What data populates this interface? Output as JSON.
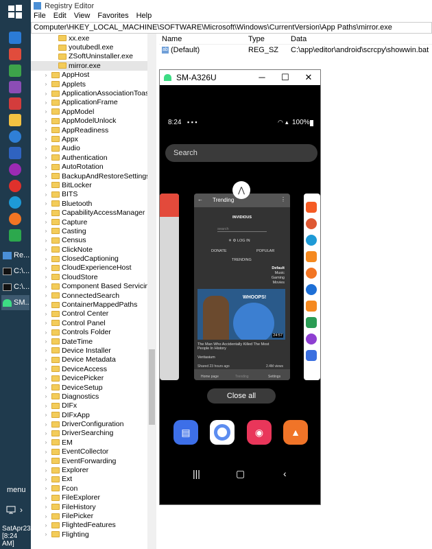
{
  "taskbar": {
    "apps": [
      {
        "label": "Re..."
      },
      {
        "label": "C:\\..."
      },
      {
        "label": "C:\\..."
      },
      {
        "label": "SM..."
      }
    ],
    "menu_label": "menu",
    "clock": {
      "date": "SatApr23",
      "time": "[8:24 AM]"
    }
  },
  "registry": {
    "title": "Registry Editor",
    "menu": [
      "File",
      "Edit",
      "View",
      "Favorites",
      "Help"
    ],
    "address": "Computer\\HKEY_LOCAL_MACHINE\\SOFTWARE\\Microsoft\\Windows\\CurrentVersion\\App Paths\\mirror.exe",
    "tree_children": [
      "xx.exe",
      "youtubedl.exe",
      "ZSoftUninstaller.exe",
      "mirror.exe"
    ],
    "tree_items": [
      "AppHost",
      "Applets",
      "ApplicationAssociationToasts",
      "ApplicationFrame",
      "AppModel",
      "AppModelUnlock",
      "AppReadiness",
      "Appx",
      "Audio",
      "Authentication",
      "AutoRotation",
      "BackupAndRestoreSettings",
      "BitLocker",
      "BITS",
      "Bluetooth",
      "CapabilityAccessManager",
      "Capture",
      "Casting",
      "Census",
      "ClickNote",
      "ClosedCaptioning",
      "CloudExperienceHost",
      "CloudStore",
      "Component Based Servicing",
      "ConnectedSearch",
      "ContainerMappedPaths",
      "Control Center",
      "Control Panel",
      "Controls Folder",
      "DateTime",
      "Device Installer",
      "Device Metadata",
      "DeviceAccess",
      "DevicePicker",
      "DeviceSetup",
      "Diagnostics",
      "DIFx",
      "DIFxApp",
      "DriverConfiguration",
      "DriverSearching",
      "EM",
      "EventCollector",
      "EventForwarding",
      "Explorer",
      "Ext",
      "Fcon",
      "FileExplorer",
      "FileHistory",
      "FilePicker",
      "FlightedFeatures",
      "Flighting"
    ],
    "columns": [
      "Name",
      "Type",
      "Data"
    ],
    "values": [
      {
        "name": "(Default)",
        "type": "REG_SZ",
        "data": "C:\\app\\editor\\android\\scrcpy\\showwin.bat"
      }
    ]
  },
  "phone": {
    "window_title": "SM-A326U",
    "time": "8:24",
    "battery": "100%",
    "search_placeholder": "Search",
    "card": {
      "header": "Trending",
      "app_logo": "INVIDIOUS",
      "search": "search",
      "login": "LOG IN",
      "donate": "DONATE",
      "popular": "POPULAR",
      "trending": "TRENDING",
      "filters": [
        "Default",
        "Music",
        "Gaming",
        "Movies"
      ],
      "thumb_text": "WHOOPS!",
      "duration": "24:57",
      "video_title": "The Man Who Accidentally Killed The Most People In History",
      "channel": "Veritasium",
      "shared": "Shared 23 hours ago",
      "views": "2.4M views",
      "nav": [
        "Home page",
        "Trending",
        "Settings"
      ]
    },
    "close_all": "Close all"
  }
}
